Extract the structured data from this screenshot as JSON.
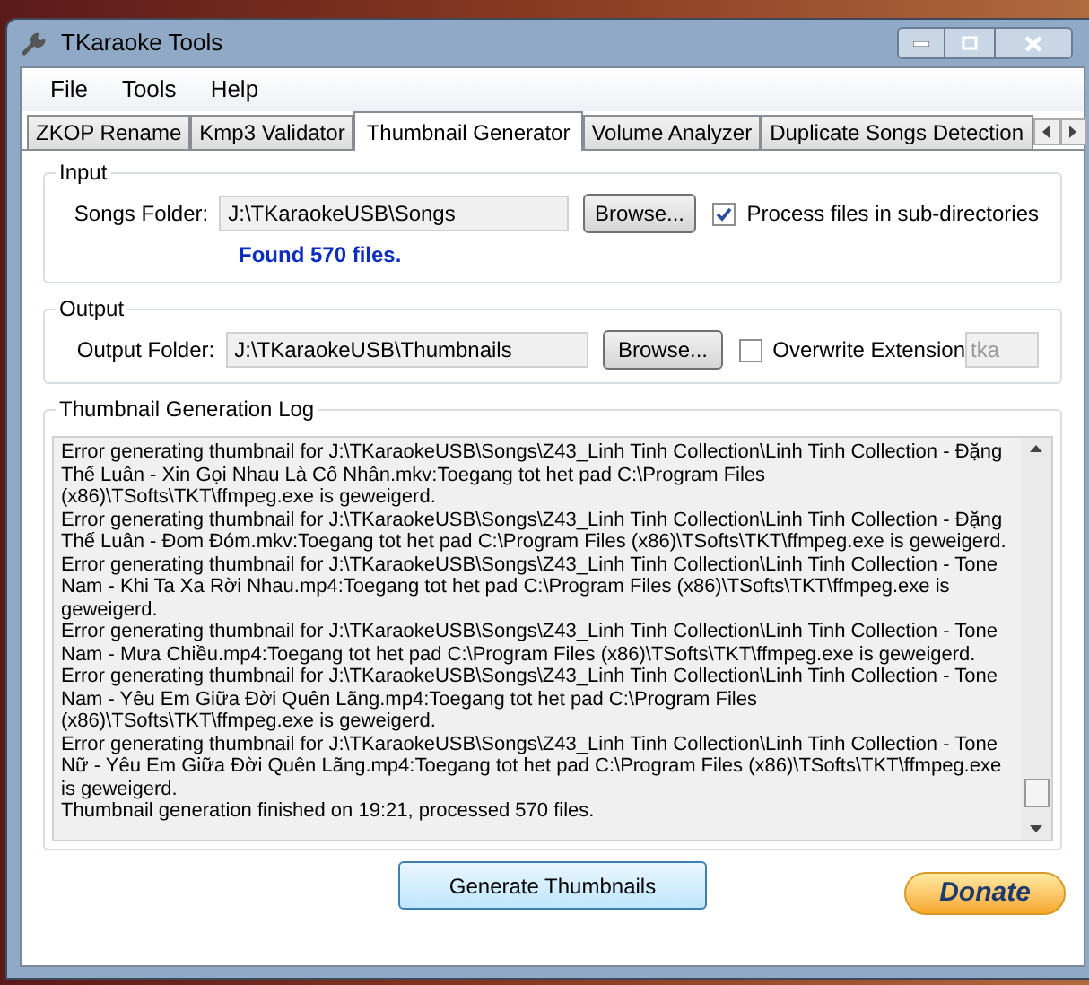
{
  "window": {
    "title": "TKaraoke Tools"
  },
  "menu": [
    "File",
    "Tools",
    "Help"
  ],
  "tabs": [
    {
      "label": "ZKOP Rename",
      "selected": false
    },
    {
      "label": "Kmp3 Validator",
      "selected": false
    },
    {
      "label": "Thumbnail Generator",
      "selected": true
    },
    {
      "label": "Volume Analyzer",
      "selected": false
    },
    {
      "label": "Duplicate Songs Detection",
      "selected": false
    }
  ],
  "input": {
    "title": "Input",
    "label": "Songs Folder:",
    "value": "J:\\TKaraokeUSB\\Songs",
    "browse": "Browse...",
    "option": {
      "label": "Process files in sub-directories",
      "checked": true
    },
    "status": "Found 570 files."
  },
  "output": {
    "title": "Output",
    "label": "Output Folder:",
    "value": "J:\\TKaraokeUSB\\Thumbnails",
    "browse": "Browse...",
    "option": {
      "label": "Overwrite Extension",
      "checked": false
    },
    "extension": "tka"
  },
  "log": {
    "title": "Thumbnail Generation Log",
    "entries": [
      "Error generating thumbnail for J:\\TKaraokeUSB\\Songs\\Z43_Linh Tinh Collection\\Linh Tinh Collection - Đặng Thế Luân - Xin Gọi Nhau Là Cố Nhân.mkv:Toegang tot het pad C:\\Program Files (x86)\\TSofts\\TKT\\ffmpeg.exe is geweigerd.",
      "Error generating thumbnail for J:\\TKaraokeUSB\\Songs\\Z43_Linh Tinh Collection\\Linh Tinh Collection - Đặng Thế Luân - Đom Đóm.mkv:Toegang tot het pad C:\\Program Files (x86)\\TSofts\\TKT\\ffmpeg.exe is geweigerd.",
      "Error generating thumbnail for J:\\TKaraokeUSB\\Songs\\Z43_Linh Tinh Collection\\Linh Tinh Collection - Tone Nam - Khi Ta Xa Rời Nhau.mp4:Toegang tot het pad C:\\Program Files (x86)\\TSofts\\TKT\\ffmpeg.exe is geweigerd.",
      "Error generating thumbnail for J:\\TKaraokeUSB\\Songs\\Z43_Linh Tinh Collection\\Linh Tinh Collection - Tone Nam - Mưa Chiều.mp4:Toegang tot het pad C:\\Program Files (x86)\\TSofts\\TKT\\ffmpeg.exe is geweigerd.",
      "Error generating thumbnail for J:\\TKaraokeUSB\\Songs\\Z43_Linh Tinh Collection\\Linh Tinh Collection - Tone Nam - Yêu Em Giữa Đời Quên Lãng.mp4:Toegang tot het pad C:\\Program Files (x86)\\TSofts\\TKT\\ffmpeg.exe is geweigerd.",
      "Error generating thumbnail for J:\\TKaraokeUSB\\Songs\\Z43_Linh Tinh Collection\\Linh Tinh Collection - Tone Nữ - Yêu Em Giữa Đời Quên Lãng.mp4:Toegang tot het pad C:\\Program Files (x86)\\TSofts\\TKT\\ffmpeg.exe is geweigerd.",
      "Thumbnail generation finished on 19:21, processed 570 files."
    ]
  },
  "generate_button": "Generate Thumbnails",
  "donate_button": "Donate"
}
